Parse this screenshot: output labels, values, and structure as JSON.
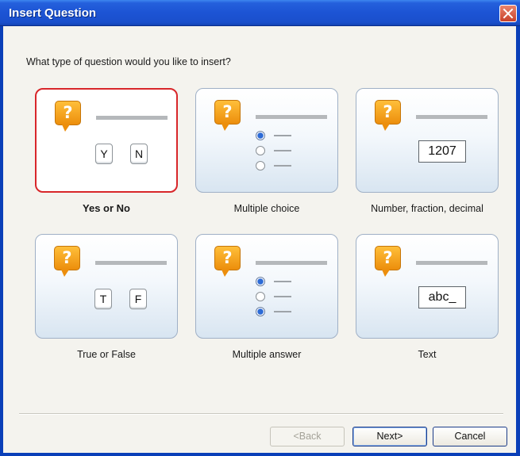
{
  "window": {
    "title": "Insert Question"
  },
  "prompt": "What type of question would you like to insert?",
  "icon_glyph": "?",
  "options": [
    {
      "label": "Yes or No",
      "selected": true,
      "keys": [
        "Y",
        "N"
      ]
    },
    {
      "label": "Multiple choice",
      "selected": false,
      "radios": [
        true,
        false,
        false
      ]
    },
    {
      "label": "Number, fraction, decimal",
      "selected": false,
      "field_value": "1207"
    },
    {
      "label": "True or False",
      "selected": false,
      "keys": [
        "T",
        "F"
      ]
    },
    {
      "label": "Multiple answer",
      "selected": false,
      "radios": [
        true,
        false,
        true
      ]
    },
    {
      "label": "Text",
      "selected": false,
      "field_value": "abc_"
    }
  ],
  "buttons": {
    "back": "<Back",
    "next": "Next>",
    "cancel": "Cancel"
  },
  "colors": {
    "title_bar": "#1c54d4",
    "selection_border": "#d8262a",
    "question_icon": "#ec8e0c"
  }
}
